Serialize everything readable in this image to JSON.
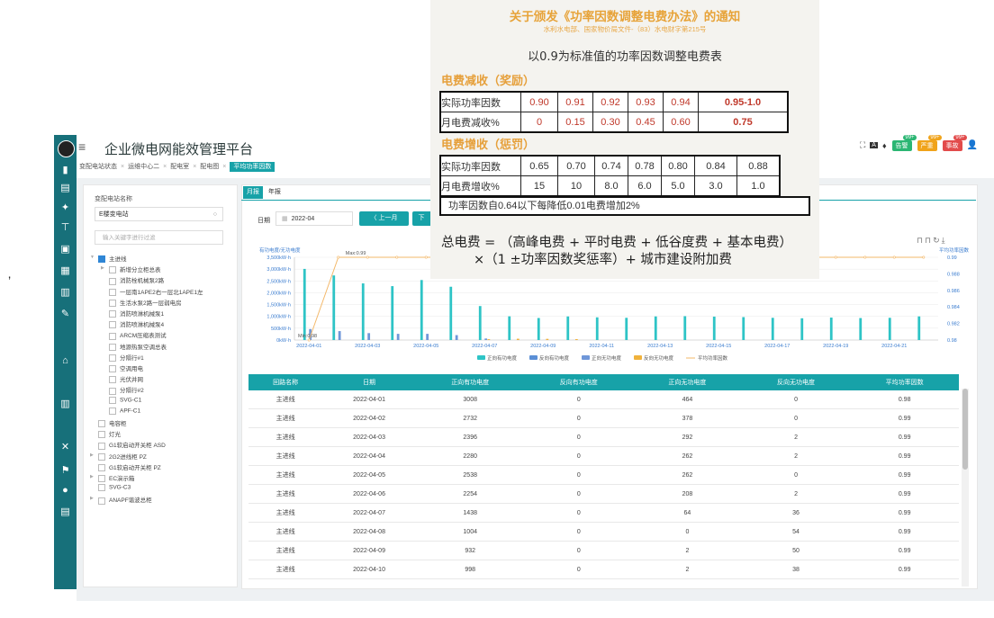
{
  "app": {
    "title": "企业微电网能效管理平台"
  },
  "breadcrumbs": [
    "变配电站状态",
    "运维中心二",
    "配电室",
    "配电图",
    "平均功率因数"
  ],
  "header_badges": [
    {
      "label": "告警",
      "count": "99+",
      "color": "#2bb673"
    },
    {
      "label": "严重",
      "count": "99+",
      "color": "#f0a31a"
    },
    {
      "label": "事故",
      "count": "99+",
      "color": "#e24b4b"
    }
  ],
  "sidebar_icons": [
    "logo",
    "chart-bar-icon",
    "document-icon",
    "settings-icon",
    "meter-icon",
    "report-icon",
    "grid-icon",
    "monitor-icon",
    "edit-icon",
    "home-icon",
    "building-icon",
    "tools-icon",
    "flag-icon",
    "user-icon",
    "list-icon"
  ],
  "tree": {
    "label": "变配电站名称",
    "selected_station": "E楼变电站",
    "filter_placeholder": "输入关键字进行过滤",
    "nodes": [
      {
        "text": "主进线",
        "level": 0,
        "checked": true,
        "expand": true
      },
      {
        "text": "新增分立柜总表",
        "level": 1,
        "checked": false,
        "expand": true
      },
      {
        "text": "消防栓机械泵2路",
        "level": 1,
        "checked": false
      },
      {
        "text": "一层南1APE2右一层北1APE1左",
        "level": 1,
        "checked": false
      },
      {
        "text": "生活水泵2路一层弱电房",
        "level": 1,
        "checked": false
      },
      {
        "text": "消防喷淋机械泵1",
        "level": 1,
        "checked": false
      },
      {
        "text": "消防喷淋机械泵4",
        "level": 1,
        "checked": false
      },
      {
        "text": "ARCM压缩表测试",
        "level": 1,
        "checked": false
      },
      {
        "text": "地源热泵空调总表",
        "level": 1,
        "checked": false
      },
      {
        "text": "分隔行#1",
        "level": 1,
        "checked": false
      },
      {
        "text": "空调用电",
        "level": 1,
        "checked": false
      },
      {
        "text": "光伏并网",
        "level": 1,
        "checked": false
      },
      {
        "text": "分隔行#2",
        "level": 1,
        "checked": false
      },
      {
        "text": "SVG-C1",
        "level": 1,
        "checked": false
      },
      {
        "text": "APF-C1",
        "level": 1,
        "checked": false
      },
      {
        "text": "电容柜",
        "level": 0,
        "checked": false
      },
      {
        "text": "灯光",
        "level": 0,
        "checked": false
      },
      {
        "text": "G1软启动开关柜 ASD",
        "level": 0,
        "checked": false
      },
      {
        "text": "2G2进线柜 PZ",
        "level": 0,
        "checked": false,
        "expand": true
      },
      {
        "text": "G1软启动开关柜 PZ",
        "level": 0,
        "checked": false
      },
      {
        "text": "EC演示箱",
        "level": 0,
        "checked": false,
        "expand": true
      },
      {
        "text": "SVG-C3",
        "level": 0,
        "checked": false
      },
      {
        "text": "ANAPF谐波总柜",
        "level": 0,
        "checked": false,
        "expand": true
      }
    ]
  },
  "tabs": {
    "month": "月报",
    "year": "年报"
  },
  "date": {
    "label": "日期",
    "value": "2022-04",
    "prev": "〈 上一月",
    "next": "下"
  },
  "tools_icons": [
    "line-chart-icon",
    "bar-chart-icon",
    "refresh-icon",
    "download-icon"
  ],
  "chart_data": {
    "type": "bar",
    "left_axis_label": "有功电度/无功电度",
    "right_axis_label": "平均功率因数",
    "left_ticks": [
      "3,500kW·h",
      "3,000kW·h",
      "2,500kW·h",
      "2,000kW·h",
      "1,500kW·h",
      "1,000kW·h",
      "500kW·h",
      "0kW·h"
    ],
    "right_ticks": [
      "0.99",
      "0.988",
      "0.986",
      "0.984",
      "0.982",
      "0.98"
    ],
    "x_ticks": [
      "2022-04-01",
      "2022-04-03",
      "2022-04-05",
      "2022-04-07",
      "2022-04-09",
      "2022-04-11",
      "2022-04-13",
      "2022-04-15",
      "2022-04-17",
      "2022-04-19",
      "2022-04-21"
    ],
    "max_label": "Max:0.99",
    "min_label": "Min:0.98",
    "categories": [
      "2022-04-01",
      "2022-04-02",
      "2022-04-03",
      "2022-04-04",
      "2022-04-05",
      "2022-04-06",
      "2022-04-07",
      "2022-04-08",
      "2022-04-09",
      "2022-04-10",
      "2022-04-11",
      "2022-04-12",
      "2022-04-13",
      "2022-04-14",
      "2022-04-15",
      "2022-04-16",
      "2022-04-17",
      "2022-04-18",
      "2022-04-19",
      "2022-04-20",
      "2022-04-21",
      "2022-04-22"
    ],
    "series": [
      {
        "name": "正向有功电度",
        "color": "#2ec4c6",
        "values": [
          3008,
          2732,
          2396,
          2280,
          2538,
          2254,
          1438,
          1004,
          932,
          998,
          960,
          940,
          1000,
          1010,
          990,
          970,
          940,
          920,
          950,
          930,
          940,
          1000
        ]
      },
      {
        "name": "反向有功电度",
        "color": "#5b8fd6",
        "values": [
          0,
          0,
          0,
          0,
          0,
          0,
          0,
          0,
          0,
          0,
          0,
          0,
          0,
          0,
          0,
          0,
          0,
          0,
          0,
          0,
          0,
          0
        ]
      },
      {
        "name": "正向无功电度",
        "color": "#6f97d9",
        "values": [
          464,
          378,
          292,
          262,
          262,
          208,
          64,
          0,
          2,
          2,
          0,
          0,
          0,
          0,
          0,
          0,
          0,
          0,
          0,
          0,
          0,
          0
        ]
      },
      {
        "name": "反向无功电度",
        "color": "#f0b23c",
        "values": [
          0,
          0,
          2,
          2,
          0,
          2,
          36,
          54,
          50,
          38,
          0,
          0,
          0,
          0,
          0,
          0,
          0,
          0,
          0,
          0,
          0,
          0
        ]
      }
    ],
    "line": {
      "name": "平均功率因数",
      "color": "#f3b86a",
      "values": [
        0.98,
        0.99,
        0.99,
        0.99,
        0.99,
        0.99,
        0.99,
        0.99,
        0.99,
        0.99,
        0.99,
        0.99,
        0.99,
        0.99,
        0.99,
        0.99,
        0.99,
        0.99,
        0.99,
        0.99,
        0.99,
        0.99
      ]
    },
    "ylim": [
      0,
      3500
    ],
    "y2lim": [
      0.98,
      0.99
    ]
  },
  "table": {
    "headers": [
      "回路名称",
      "日期",
      "正向有功电度",
      "反向有功电度",
      "正向无功电度",
      "反向无功电度",
      "平均功率因数"
    ],
    "rows": [
      [
        "主进线",
        "2022-04-01",
        "3008",
        "0",
        "464",
        "0",
        "0.98"
      ],
      [
        "主进线",
        "2022-04-02",
        "2732",
        "0",
        "378",
        "0",
        "0.99"
      ],
      [
        "主进线",
        "2022-04-03",
        "2396",
        "0",
        "292",
        "2",
        "0.99"
      ],
      [
        "主进线",
        "2022-04-04",
        "2280",
        "0",
        "262",
        "2",
        "0.99"
      ],
      [
        "主进线",
        "2022-04-05",
        "2538",
        "0",
        "262",
        "0",
        "0.99"
      ],
      [
        "主进线",
        "2022-04-06",
        "2254",
        "0",
        "208",
        "2",
        "0.99"
      ],
      [
        "主进线",
        "2022-04-07",
        "1438",
        "0",
        "64",
        "36",
        "0.99"
      ],
      [
        "主进线",
        "2022-04-08",
        "1004",
        "0",
        "0",
        "54",
        "0.99"
      ],
      [
        "主进线",
        "2022-04-09",
        "932",
        "0",
        "2",
        "50",
        "0.99"
      ],
      [
        "主进线",
        "2022-04-10",
        "998",
        "0",
        "2",
        "38",
        "0.99"
      ]
    ]
  },
  "overlay": {
    "title": "关于颁发《功率因数调整电费办法》的通知",
    "subtitle": "水利水电部、国家物价局文件-（83）水电财字第215号",
    "heading": "以0.9为标准值的功率因数调整电费表",
    "reward_title": "电费减收（奖励）",
    "reward_rows": [
      [
        "实际功率因数",
        "0.90",
        "0.91",
        "0.92",
        "0.93",
        "0.94",
        "0.95-1.0"
      ],
      [
        "月电费减收%",
        "0",
        "0.15",
        "0.30",
        "0.45",
        "0.60",
        "0.75"
      ]
    ],
    "penalty_title": "电费增收（惩罚）",
    "penalty_rows": [
      [
        "实际功率因数",
        "0.65",
        "0.70",
        "0.74",
        "0.78",
        "0.80",
        "0.84",
        "0.88"
      ],
      [
        "月电费增收%",
        "15",
        "10",
        "8.0",
        "6.0",
        "5.0",
        "3.0",
        "1.0"
      ]
    ],
    "note": "功率因数自0.64以下每降低0.01电费增加2%",
    "formula1": "总电费 = （高峰电费 + 平时电费 + 低谷度费 + 基本电费）",
    "formula2": "×（1 ±功率因数奖惩率）+ 城市建设附加费"
  },
  "quote_char": "’"
}
